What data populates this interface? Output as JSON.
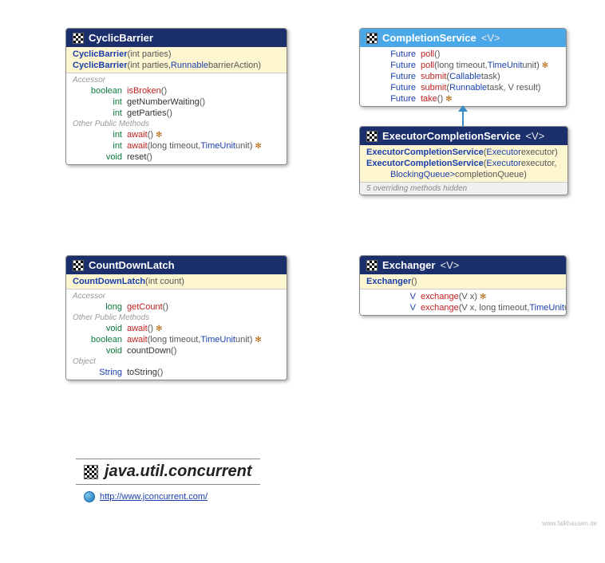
{
  "package": {
    "name": "java.util.concurrent",
    "link": "http://www.jconcurrent.com/"
  },
  "watermark": "www.falkhausen.de",
  "classes": {
    "cyclicBarrier": {
      "name": "CyclicBarrier",
      "constructors": [
        {
          "name": "CyclicBarrier",
          "params": "(int parties)"
        },
        {
          "name": "CyclicBarrier",
          "params_pre": "(int parties, ",
          "params_type": "Runnable",
          "params_post": " barrierAction)"
        }
      ],
      "sections": [
        {
          "label": "Accessor",
          "rows": [
            {
              "ret": "boolean",
              "retClass": "ret-kw",
              "name": "isBroken",
              "nameClass": "name-method",
              "params": "()"
            },
            {
              "ret": "int",
              "retClass": "ret-kw",
              "name": "getNumberWaiting",
              "nameClass": "name-plain",
              "params": "()"
            },
            {
              "ret": "int",
              "retClass": "ret-kw",
              "name": "getParties",
              "nameClass": "name-plain",
              "params": "()"
            }
          ]
        },
        {
          "label": "Other Public Methods",
          "rows": [
            {
              "ret": "int",
              "retClass": "ret-kw",
              "name": "await",
              "nameClass": "name-method",
              "params": "()",
              "throws": true
            },
            {
              "ret": "int",
              "retClass": "ret-kw",
              "name": "await",
              "nameClass": "name-method",
              "params_pre": "(long timeout, ",
              "params_type": "TimeUnit",
              "params_post": " unit)",
              "throws": true
            },
            {
              "ret": "void",
              "retClass": "ret-kw",
              "name": "reset",
              "nameClass": "name-plain",
              "params": "()"
            }
          ]
        }
      ]
    },
    "completionService": {
      "name": "CompletionService",
      "typeParam": "<V>",
      "rows": [
        {
          "ret": "Future<V>",
          "retClass": "ret-blue",
          "name": "poll",
          "nameClass": "name-method",
          "params": "()"
        },
        {
          "ret": "Future<V>",
          "retClass": "ret-blue",
          "name": "poll",
          "nameClass": "name-method",
          "params_pre": "(long timeout, ",
          "params_type": "TimeUnit",
          "params_post": " unit)",
          "throws": true
        },
        {
          "ret": "Future<V>",
          "retClass": "ret-blue",
          "name": "submit",
          "nameClass": "name-method",
          "params_pre": "(",
          "params_type": "Callable<V>",
          "params_post": " task)"
        },
        {
          "ret": "Future<V>",
          "retClass": "ret-blue",
          "name": "submit",
          "nameClass": "name-method",
          "params_pre": "(",
          "params_type": "Runnable",
          "params_post": " task, V result)"
        },
        {
          "ret": "Future<V>",
          "retClass": "ret-blue",
          "name": "take",
          "nameClass": "name-method",
          "params": "()",
          "throws": true
        }
      ]
    },
    "executorCompletionService": {
      "name": "ExecutorCompletionService",
      "typeParam": "<V>",
      "constructors": [
        {
          "name": "ExecutorCompletionService",
          "params_pre": "(",
          "params_type": "Executor",
          "params_post": " executor)"
        },
        {
          "name": "ExecutorCompletionService",
          "params_pre": "(",
          "params_type": "Executor",
          "params_post": " executor,",
          "line2_type": "BlockingQueue<Future<V>>",
          "line2_post": " completionQueue)"
        }
      ],
      "hidden": "5 overriding methods hidden"
    },
    "countDownLatch": {
      "name": "CountDownLatch",
      "constructors": [
        {
          "name": "CountDownLatch",
          "params": "(int count)"
        }
      ],
      "sections": [
        {
          "label": "Accessor",
          "rows": [
            {
              "ret": "long",
              "retClass": "ret-kw",
              "name": "getCount",
              "nameClass": "name-method",
              "params": "()"
            }
          ]
        },
        {
          "label": "Other Public Methods",
          "rows": [
            {
              "ret": "void",
              "retClass": "ret-kw",
              "name": "await",
              "nameClass": "name-method",
              "params": "()",
              "throws": true
            },
            {
              "ret": "boolean",
              "retClass": "ret-kw",
              "name": "await",
              "nameClass": "name-method",
              "params_pre": "(long timeout, ",
              "params_type": "TimeUnit",
              "params_post": " unit)",
              "throws": true
            },
            {
              "ret": "void",
              "retClass": "ret-kw",
              "name": "countDown",
              "nameClass": "name-plain",
              "params": "()"
            }
          ]
        },
        {
          "label": "Object",
          "rows": [
            {
              "ret": "String",
              "retClass": "ret-blue",
              "name": "toString",
              "nameClass": "name-plain",
              "params": "()"
            }
          ]
        }
      ]
    },
    "exchanger": {
      "name": "Exchanger",
      "typeParam": "<V>",
      "constructors": [
        {
          "name": "Exchanger",
          "params": "()"
        }
      ],
      "rows": [
        {
          "ret": "V",
          "retClass": "ret-blue",
          "name": "exchange",
          "nameClass": "name-method",
          "params": "(V x)",
          "throws": true
        },
        {
          "ret": "V",
          "retClass": "ret-blue",
          "name": "exchange",
          "nameClass": "name-method",
          "params_pre": "(V x, long timeout, ",
          "params_type": "TimeUnit",
          "params_post": " unit)",
          "throws": true
        }
      ]
    }
  }
}
